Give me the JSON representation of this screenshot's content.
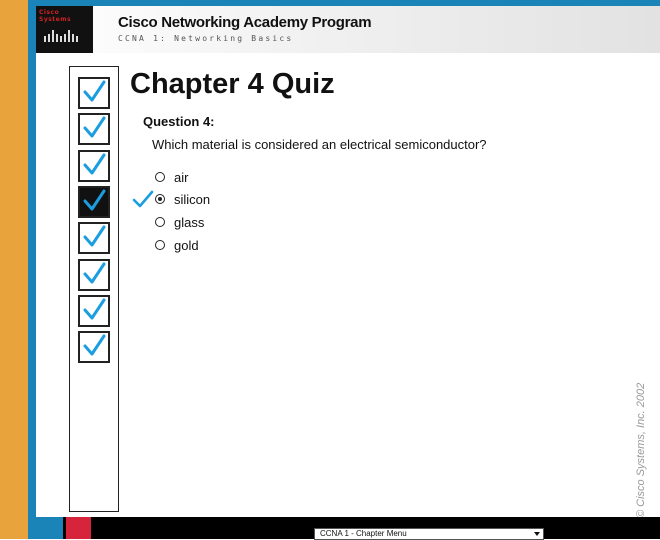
{
  "header": {
    "logo_text": "Cisco Systems",
    "program_title": "Cisco Networking Academy Program",
    "program_subtitle": "CCNA 1: Networking Basics"
  },
  "quiz": {
    "title": "Chapter 4 Quiz",
    "question_label": "Question 4:",
    "question_text": "Which material is considered an electrical semiconductor?",
    "options": [
      {
        "label": "air",
        "selected": false
      },
      {
        "label": "silicon",
        "selected": true
      },
      {
        "label": "glass",
        "selected": false
      },
      {
        "label": "gold",
        "selected": false
      }
    ]
  },
  "progress": {
    "total_questions": 8,
    "current_question": 4,
    "check_color": "#1a9ee0"
  },
  "copyright": "© Cisco Systems, Inc. 2002",
  "footer": {
    "chapter_menu_value": "CCNA 1 - Chapter Menu"
  },
  "colors": {
    "accent_blue": "#1a84b8",
    "accent_orange": "#e8a33c",
    "accent_red": "#d6253a"
  }
}
